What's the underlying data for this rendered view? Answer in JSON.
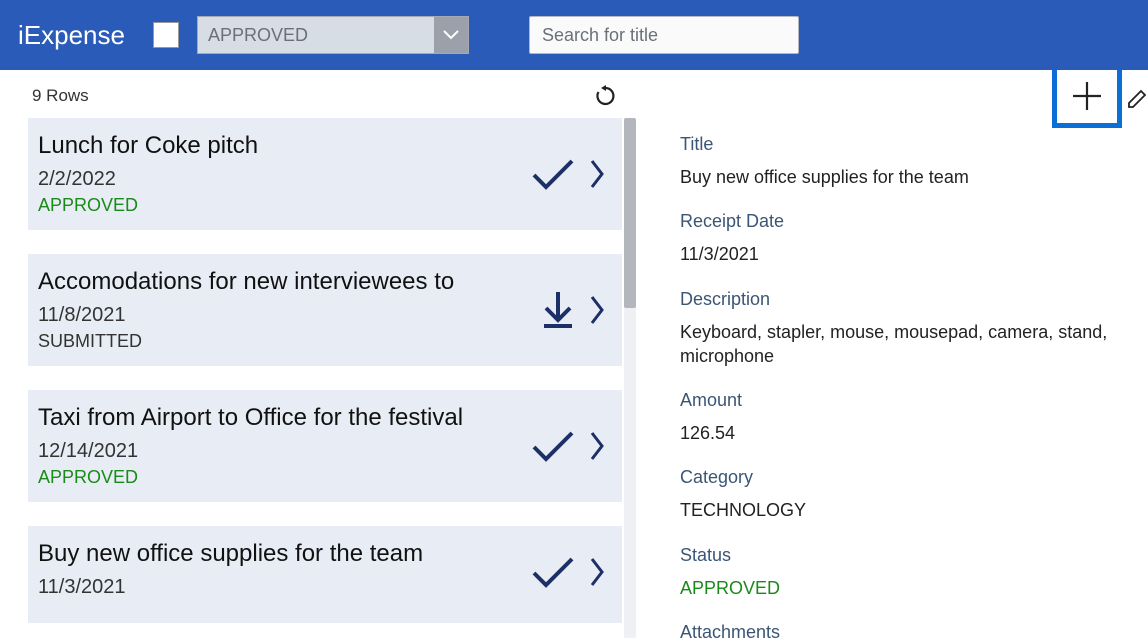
{
  "header": {
    "app_title": "iExpense",
    "filter_value": "APPROVED",
    "search_placeholder": "Search for title"
  },
  "list": {
    "rows_label": "9 Rows",
    "items": [
      {
        "title": "Lunch for Coke pitch",
        "date": "2/2/2022",
        "status": "APPROVED",
        "status_class": "approved",
        "icon": "check"
      },
      {
        "title": "Accomodations for new interviewees to",
        "date": "11/8/2021",
        "status": "SUBMITTED",
        "status_class": "submitted",
        "icon": "download"
      },
      {
        "title": "Taxi from Airport to Office for the festival",
        "date": "12/14/2021",
        "status": "APPROVED",
        "status_class": "approved",
        "icon": "check"
      },
      {
        "title": "Buy new office supplies for the team",
        "date": "11/3/2021",
        "status": "",
        "status_class": "",
        "icon": "check"
      }
    ]
  },
  "detail": {
    "fields": [
      {
        "label": "Title",
        "value": "Buy new office supplies for the team"
      },
      {
        "label": "Receipt Date",
        "value": "11/3/2021"
      },
      {
        "label": "Description",
        "value": "Keyboard, stapler, mouse, mousepad, camera, stand, microphone"
      },
      {
        "label": "Amount",
        "value": "126.54"
      },
      {
        "label": "Category",
        "value": "TECHNOLOGY"
      },
      {
        "label": "Status",
        "value": "APPROVED",
        "value_class": "approved"
      },
      {
        "label": "Attachments",
        "value": ""
      }
    ]
  }
}
